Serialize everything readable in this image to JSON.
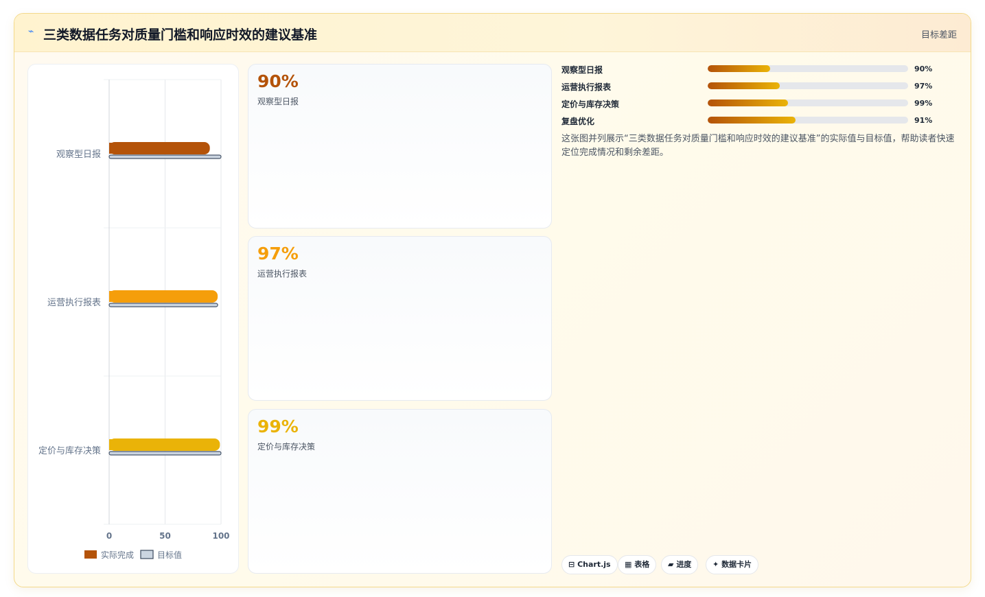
{
  "header": {
    "icon": "⌁",
    "title": "三类数据任务对质量门槛和响应时效的建议基准",
    "badge": "目标差距"
  },
  "chart_data": {
    "type": "bar",
    "orientation": "horizontal",
    "categories": [
      "观察型日报",
      "运营执行报表",
      "定价与库存决策"
    ],
    "series": [
      {
        "name": "实际完成",
        "values": [
          90,
          97,
          99
        ],
        "colors": [
          "#b45309",
          "#f59e0b",
          "#eab308"
        ]
      },
      {
        "name": "目标值",
        "values": [
          100,
          97,
          100
        ],
        "color": "#cbd5e1",
        "border": "#475569"
      }
    ],
    "xlim": [
      0,
      100
    ],
    "xticks": [
      "0",
      "50",
      "100"
    ],
    "grid": true,
    "legend": "bottom",
    "legend_items": [
      {
        "name": "实际完成",
        "color": "#b45309"
      },
      {
        "name": "目标值",
        "color": "#cbd5e1",
        "border": "#475569"
      }
    ]
  },
  "kpis": [
    {
      "value": "90%",
      "label": "观察型日报",
      "color": "#b45309"
    },
    {
      "value": "97%",
      "label": "运营执行报表",
      "color": "#f59e0b"
    },
    {
      "value": "99%",
      "label": "定价与库存决策",
      "color": "#eab308"
    }
  ],
  "progress": [
    {
      "label": "观察型日报",
      "value_text": "90%",
      "fill": 0.31
    },
    {
      "label": "运营执行报表",
      "value_text": "97%",
      "fill": 0.36
    },
    {
      "label": "定价与库存决策",
      "value_text": "99%",
      "fill": 0.4
    },
    {
      "label": "复盘优化",
      "value_text": "91%",
      "fill": 0.44
    }
  ],
  "description": "这张图并列展示“三类数据任务对质量门槛和响应时效的建议基准”的实际值与目标值，帮助读者快速定位完成情况和剩余差距。",
  "chips": [
    {
      "icon": "⊟",
      "label": "Chart.js"
    },
    {
      "icon": "▦",
      "label": "表格"
    },
    {
      "icon": "▰",
      "label": "进度"
    },
    {
      "icon": "✦",
      "label": "数据卡片"
    }
  ]
}
